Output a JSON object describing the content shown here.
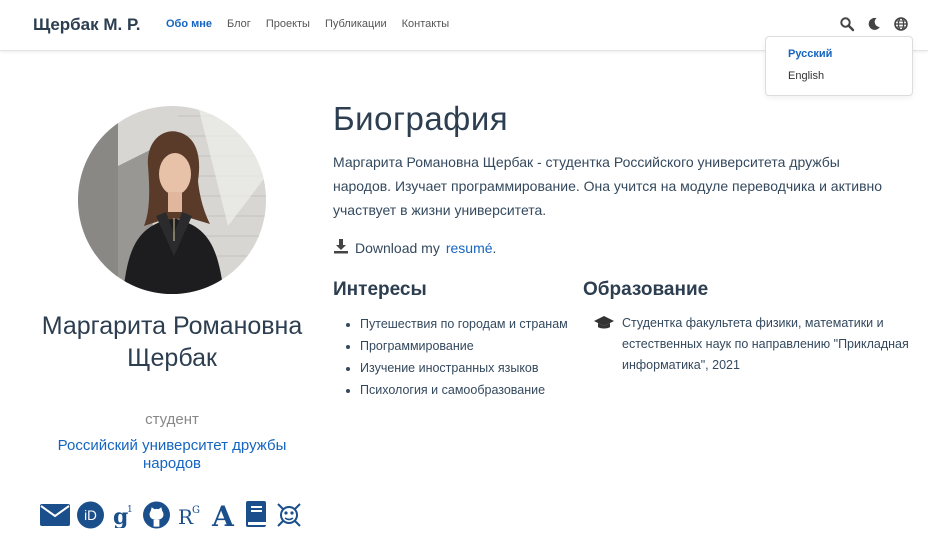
{
  "nav": {
    "brand": "Щербак М. Р.",
    "items": [
      {
        "label": "Обо мне",
        "active": true
      },
      {
        "label": "Блог"
      },
      {
        "label": "Проекты"
      },
      {
        "label": "Публикации"
      },
      {
        "label": "Контакты"
      }
    ],
    "icons": [
      "search-icon",
      "moon-icon",
      "globe-icon"
    ]
  },
  "language_menu": {
    "selected": "Русский",
    "other": "English"
  },
  "profile": {
    "name": "Маргарита Романовна Щербак",
    "role": "студент",
    "organization": "Российский университет дружбы народов",
    "social": [
      "envelope-icon",
      "orcid-icon",
      "google-scholar-icon",
      "github-icon",
      "researchgate-icon",
      "academia-icon",
      "book-icon",
      "mendeley-icon"
    ]
  },
  "bio": {
    "heading": "Биография",
    "text": "Маргарита Романовна Щербак - студентка Российского университета дружбы народов. Изучает программирование. Она учится на модуле переводчика и активно участвует в жизни университета.",
    "download_prefix": "Download my",
    "resume_link": "resumé",
    "download_suffix": "."
  },
  "interests": {
    "heading": "Интересы",
    "items": [
      "Путешествия по городам и странам",
      "Программирование",
      "Изучение иностранных языков",
      "Психология и самообразование"
    ]
  },
  "education": {
    "heading": "Образование",
    "items": [
      {
        "text": "Студентка факультета физики, математики и естественных наук по направлению \"Прикладная информатика\", 2021"
      }
    ]
  },
  "colors": {
    "accent": "#1565c0",
    "text": "#34495e",
    "heading": "#2c3e50"
  }
}
